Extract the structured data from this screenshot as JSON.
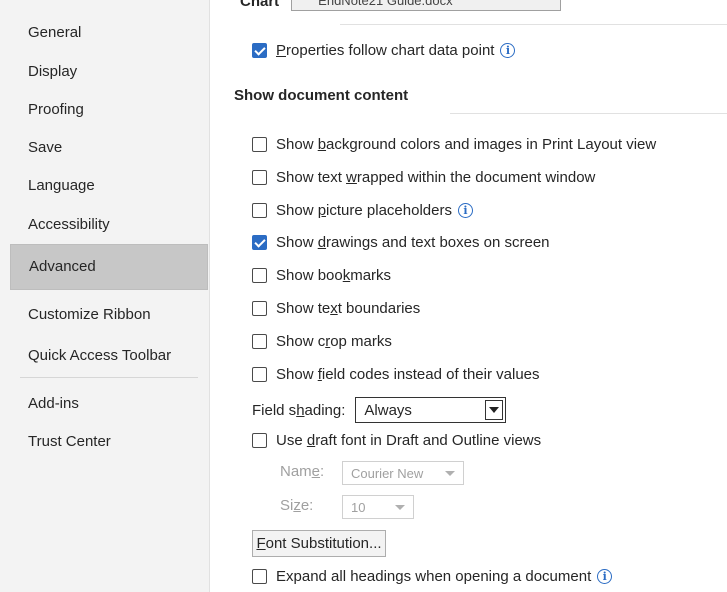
{
  "sidebar": {
    "items": [
      {
        "label": "General"
      },
      {
        "label": "Display"
      },
      {
        "label": "Proofing"
      },
      {
        "label": "Save"
      },
      {
        "label": "Language"
      },
      {
        "label": "Accessibility"
      },
      {
        "label": "Advanced",
        "selected": true
      },
      {
        "label": "Customize Ribbon"
      },
      {
        "label": "Quick Access Toolbar"
      },
      {
        "label": "Add-ins"
      },
      {
        "label": "Trust Center"
      }
    ]
  },
  "top_partial": {
    "label": "Chart",
    "value": "EndNote21 Guide.docx"
  },
  "chart_option": {
    "pre": "",
    "u": "P",
    "post": "roperties follow chart data point",
    "checked": true
  },
  "section": {
    "title": "Show document content"
  },
  "options": [
    {
      "pre": "Show ",
      "u": "b",
      "post": "ackground colors and images in Print Layout view",
      "checked": false,
      "info": false
    },
    {
      "pre": "Show text ",
      "u": "w",
      "post": "rapped within the document window",
      "checked": false,
      "info": false
    },
    {
      "pre": "Show ",
      "u": "p",
      "post": "icture placeholders",
      "checked": false,
      "info": true
    },
    {
      "pre": "Show ",
      "u": "d",
      "post": "rawings and text boxes on screen",
      "checked": true,
      "info": false
    },
    {
      "pre": "Show boo",
      "u": "k",
      "post": "marks",
      "checked": false,
      "info": false
    },
    {
      "pre": "Show te",
      "u": "x",
      "post": "t boundaries",
      "checked": false,
      "info": false
    },
    {
      "pre": "Show c",
      "u": "r",
      "post": "op marks",
      "checked": false,
      "info": false
    },
    {
      "pre": "Show ",
      "u": "f",
      "post": "ield codes instead of their values",
      "checked": false,
      "info": false
    }
  ],
  "field_shading": {
    "pre": "Field s",
    "u": "h",
    "post": "ading:",
    "value": "Always"
  },
  "draft_font": {
    "pre": "Use ",
    "u": "d",
    "post": "raft font in Draft and Outline views",
    "checked": false
  },
  "name_field": {
    "pre": "Nam",
    "u": "e",
    "post": ":",
    "value": "Courier New"
  },
  "size_field": {
    "pre": "Si",
    "u": "z",
    "post": "e:",
    "value": "10"
  },
  "font_sub_button": {
    "u": "F",
    "post": "ont Substitution..."
  },
  "expand_option": {
    "pre": "Expand all headings when opening a document",
    "checked": false
  },
  "colors": {
    "accent": "#2b6cc4",
    "selected_bg": "#c7c7c7",
    "sidebar_bg": "#f3f3f3"
  }
}
